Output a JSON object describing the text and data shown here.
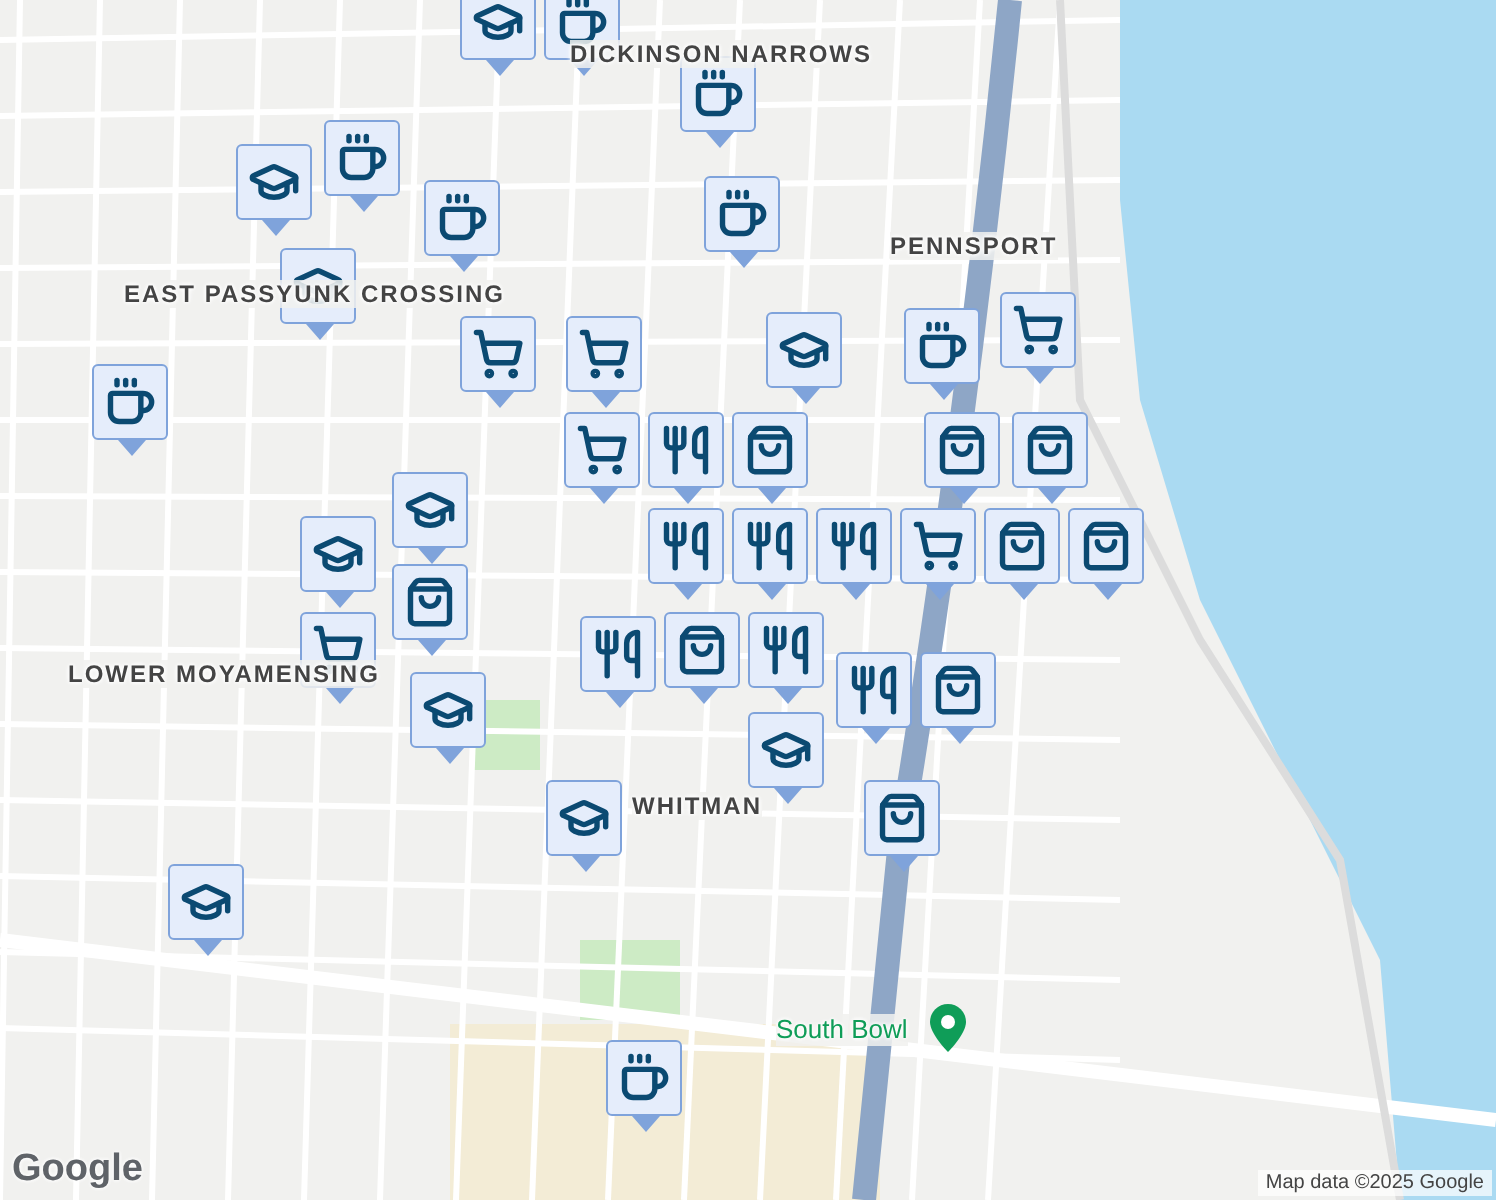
{
  "map": {
    "places": [
      {
        "name": "DICKINSON NARROWS",
        "kind": "area"
      },
      {
        "name": "PENNSPORT",
        "kind": "area"
      },
      {
        "name": "EAST PASSYUNK CROSSING",
        "kind": "area"
      },
      {
        "name": "LOWER MOYAMENSING",
        "kind": "area"
      },
      {
        "name": "WHITMAN",
        "kind": "area"
      },
      {
        "name": "South Bowl",
        "kind": "poi"
      }
    ],
    "markers": [
      {
        "kind": "school"
      },
      {
        "kind": "cafe"
      },
      {
        "kind": "cafe"
      },
      {
        "kind": "school"
      },
      {
        "kind": "cafe"
      },
      {
        "kind": "cafe"
      },
      {
        "kind": "school"
      },
      {
        "kind": "cafe"
      },
      {
        "kind": "grocery"
      },
      {
        "kind": "grocery"
      },
      {
        "kind": "school"
      },
      {
        "kind": "grocery"
      },
      {
        "kind": "cafe"
      },
      {
        "kind": "cafe"
      },
      {
        "kind": "grocery"
      },
      {
        "kind": "restaurant"
      },
      {
        "kind": "shopping"
      },
      {
        "kind": "shopping"
      },
      {
        "kind": "shopping"
      },
      {
        "kind": "restaurant"
      },
      {
        "kind": "restaurant"
      },
      {
        "kind": "restaurant"
      },
      {
        "kind": "grocery"
      },
      {
        "kind": "shopping"
      },
      {
        "kind": "shopping"
      },
      {
        "kind": "school"
      },
      {
        "kind": "school"
      },
      {
        "kind": "shopping"
      },
      {
        "kind": "grocery"
      },
      {
        "kind": "school"
      },
      {
        "kind": "restaurant"
      },
      {
        "kind": "shopping"
      },
      {
        "kind": "restaurant"
      },
      {
        "kind": "school"
      },
      {
        "kind": "restaurant"
      },
      {
        "kind": "shopping"
      },
      {
        "kind": "shopping"
      },
      {
        "kind": "school"
      },
      {
        "kind": "school"
      },
      {
        "kind": "cafe"
      }
    ],
    "logo": "Google",
    "attribution": "Map data ©2025 Google"
  }
}
